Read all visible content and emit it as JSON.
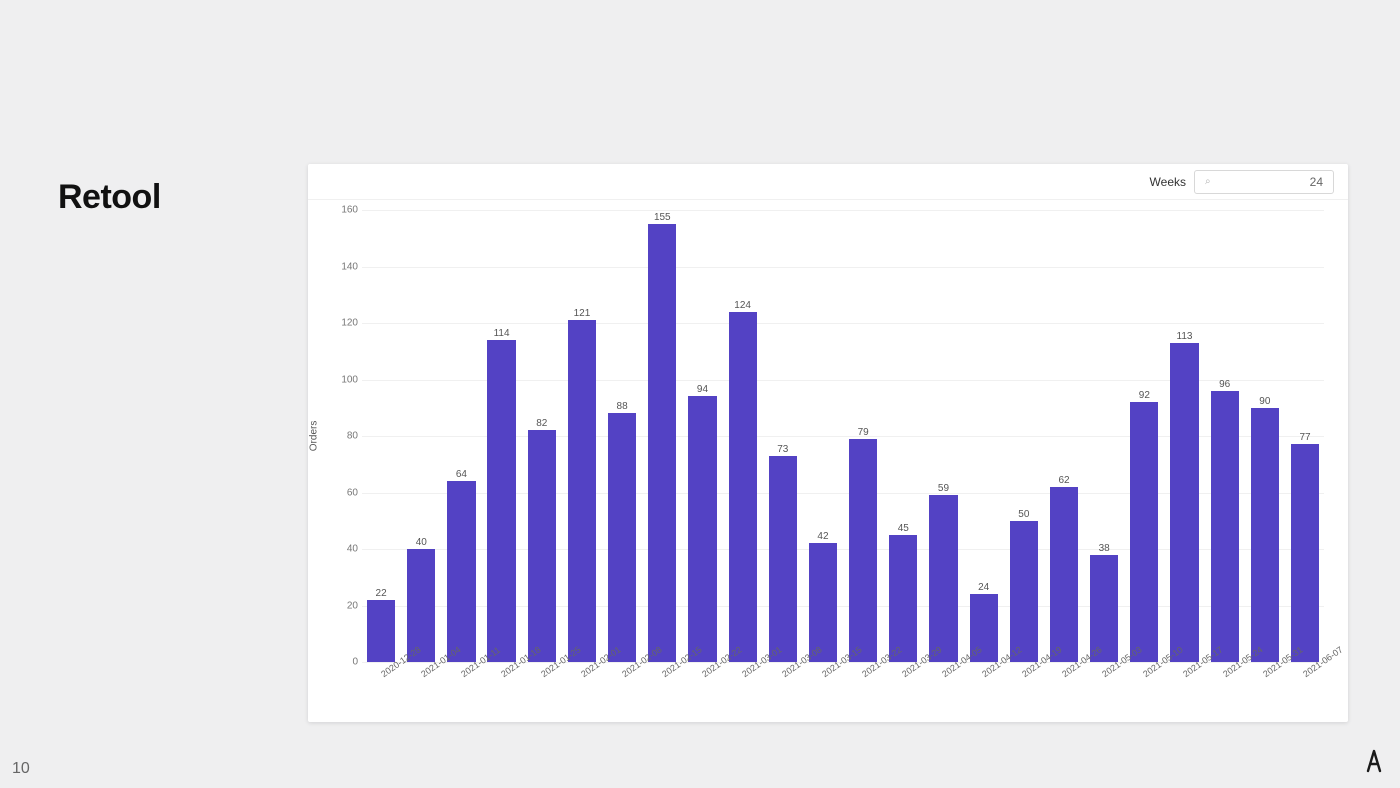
{
  "title": "Retool",
  "page_number": "10",
  "weeks_label": "Weeks",
  "weeks_icon_placeholder": "⌕",
  "weeks_value": "24",
  "chart_data": {
    "type": "bar",
    "ylabel": "Orders",
    "ylim": [
      0,
      160
    ],
    "y_ticks": [
      0,
      20,
      40,
      60,
      80,
      100,
      120,
      140,
      160
    ],
    "categories": [
      "2020-12-28",
      "2021-01-04",
      "2021-01-11",
      "2021-01-18",
      "2021-01-25",
      "2021-02-01",
      "2021-02-08",
      "2021-02-15",
      "2021-02-22",
      "2021-03-01",
      "2021-03-08",
      "2021-03-15",
      "2021-03-22",
      "2021-03-29",
      "2021-04-05",
      "2021-04-12",
      "2021-04-19",
      "2021-04-26",
      "2021-05-03",
      "2021-05-10",
      "2021-05-17",
      "2021-05-24",
      "2021-05-31",
      "2021-06-07"
    ],
    "values": [
      22,
      40,
      64,
      114,
      82,
      121,
      88,
      155,
      94,
      124,
      73,
      42,
      79,
      45,
      59,
      24,
      50,
      62,
      38,
      92,
      113,
      96,
      90,
      77
    ],
    "bar_color": "#5342c4"
  }
}
